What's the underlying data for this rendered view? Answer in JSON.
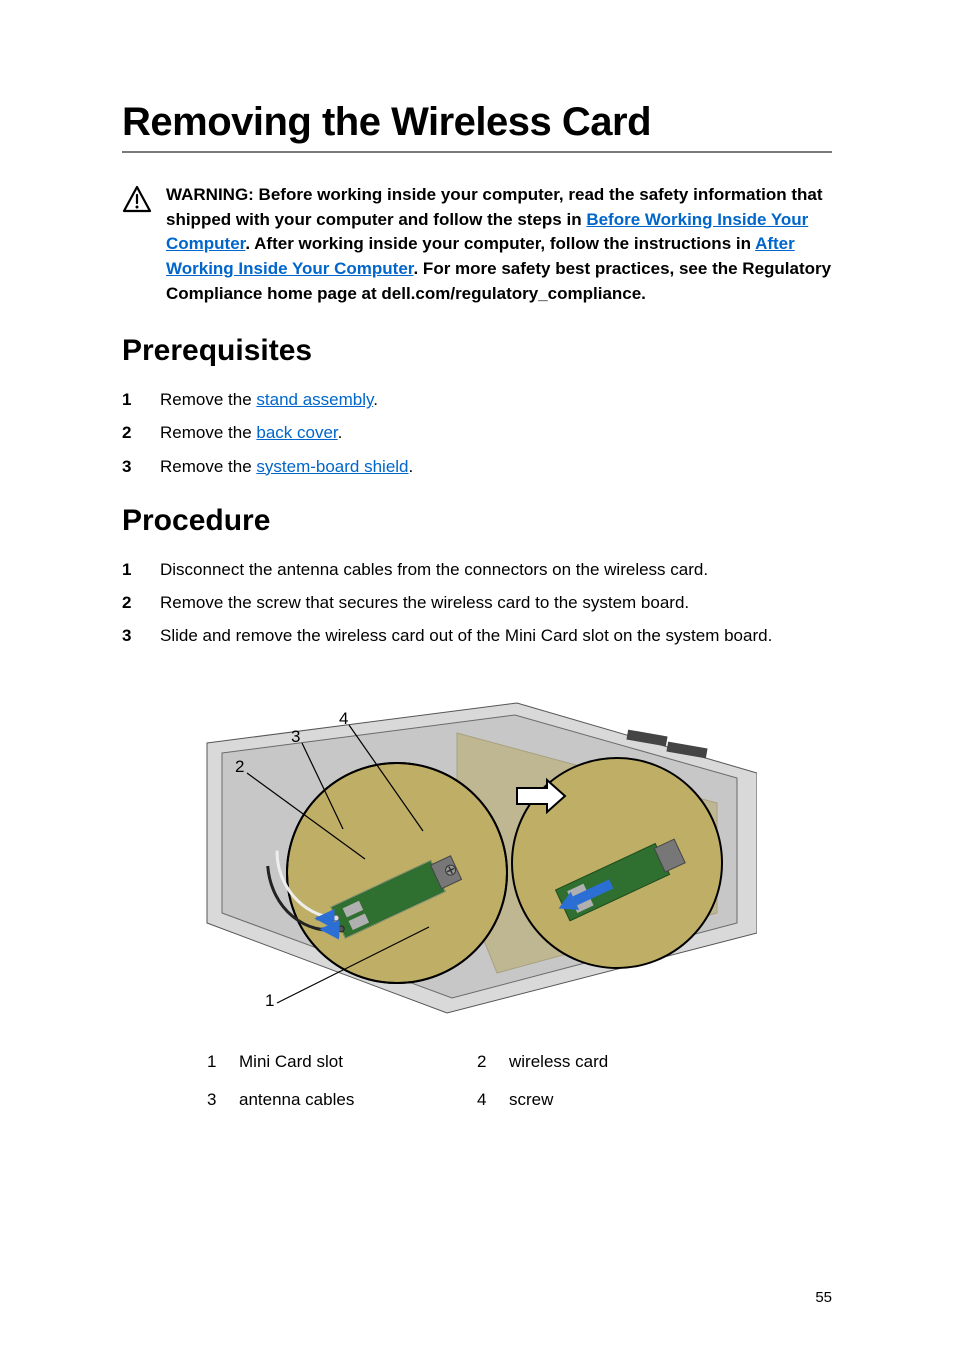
{
  "title": "Removing the Wireless Card",
  "warning": {
    "lead": "WARNING: Before working inside your computer, read the safety information that shipped with your computer and follow the steps in ",
    "link1": "Before Working Inside Your Computer",
    "mid1": ". After working inside your computer, follow the instructions in ",
    "link2": "After Working Inside Your Computer",
    "tail": ". For more safety best practices, see the Regulatory Compliance home page at dell.com/regulatory_compliance."
  },
  "sections": {
    "prerequisites": {
      "heading": "Prerequisites",
      "items": [
        {
          "pre": "Remove the ",
          "link": "stand assembly",
          "post": "."
        },
        {
          "pre": "Remove the ",
          "link": "back cover",
          "post": "."
        },
        {
          "pre": "Remove the ",
          "link": "system-board shield",
          "post": "."
        }
      ]
    },
    "procedure": {
      "heading": "Procedure",
      "items": [
        {
          "text": "Disconnect the antenna cables from the connectors on the wireless card."
        },
        {
          "text": "Remove the screw that secures the wireless card to the system board."
        },
        {
          "text": "Slide and remove the wireless card out of the Mini Card slot on the system board."
        }
      ]
    }
  },
  "figure": {
    "callouts": {
      "c1": "1",
      "c2": "2",
      "c3": "3",
      "c4": "4"
    },
    "legend": [
      {
        "num": "1",
        "label": "Mini Card slot"
      },
      {
        "num": "2",
        "label": "wireless card"
      },
      {
        "num": "3",
        "label": "antenna cables"
      },
      {
        "num": "4",
        "label": "screw"
      }
    ]
  },
  "page_number": "55"
}
